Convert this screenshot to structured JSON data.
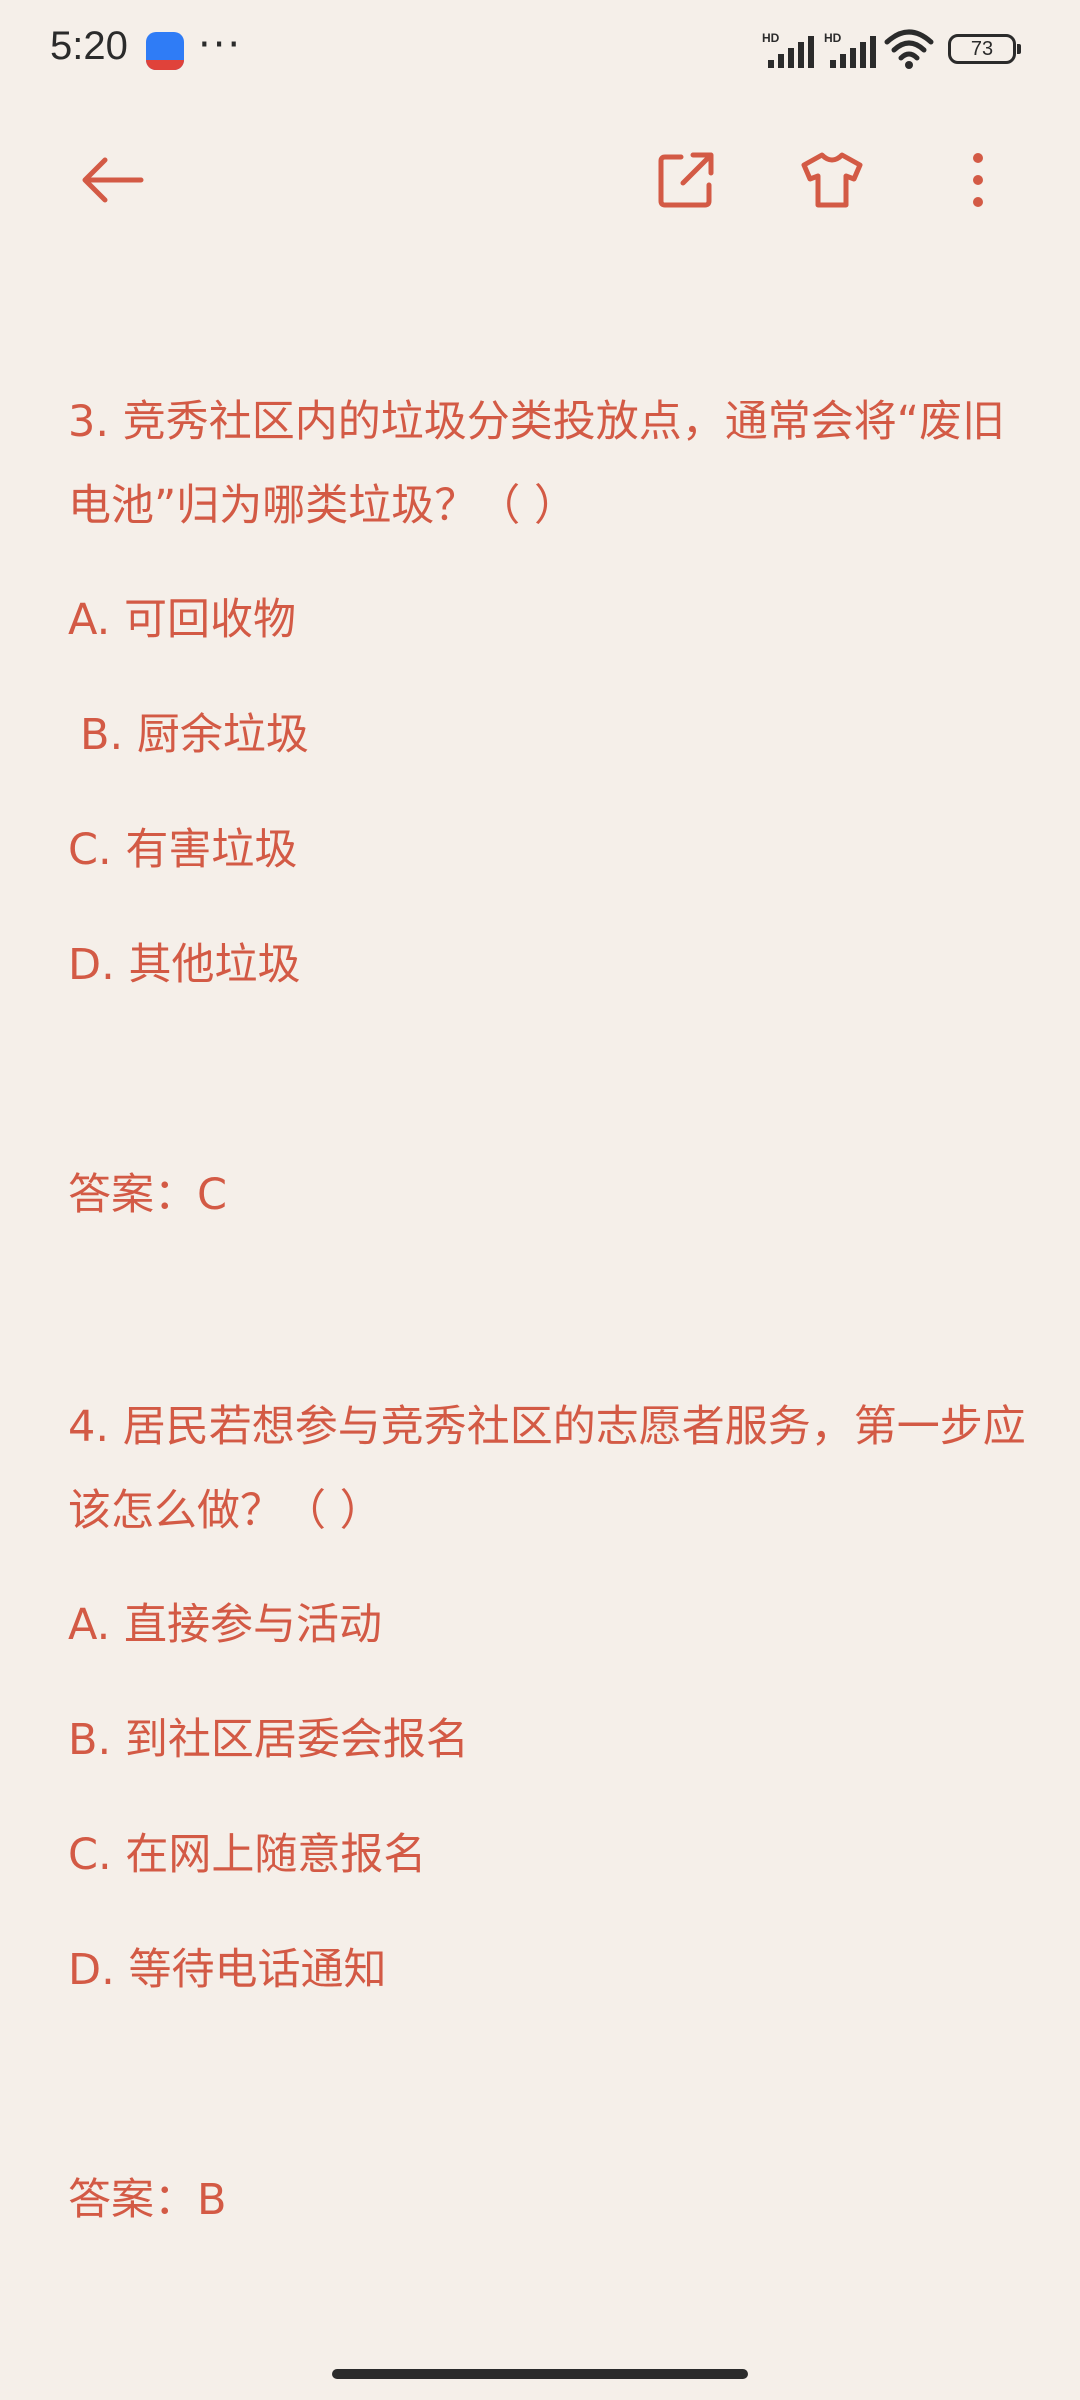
{
  "status_bar": {
    "time": "5:20",
    "notification_dots": "···",
    "battery": "73",
    "signal_label": "HD",
    "app_icon": "app-badge-icon"
  },
  "toolbar": {
    "back_icon": "arrow-left-icon",
    "share_icon": "external-share-icon",
    "theme_icon": "tshirt-icon",
    "more_icon": "more-vertical-icon"
  },
  "colors": {
    "background": "#f5efe9",
    "text": "#d35a45"
  },
  "questions": [
    {
      "title": "3. 竞秀社区内的垃圾分类投放点，通常会将“废旧电池”归为哪类垃圾？（ ）",
      "options": [
        "A. 可回收物",
        "B. 厨余垃圾",
        "C. 有害垃圾",
        "D. 其他垃圾"
      ],
      "answer": "答案：C"
    },
    {
      "title": "4. 居民若想参与竞秀社区的志愿者服务，第一步应该怎么做？（ ）",
      "options": [
        "A. 直接参与活动",
        "B. 到社区居委会报名",
        "C. 在网上随意报名",
        "D. 等待电话通知"
      ],
      "answer": "答案：B"
    }
  ]
}
